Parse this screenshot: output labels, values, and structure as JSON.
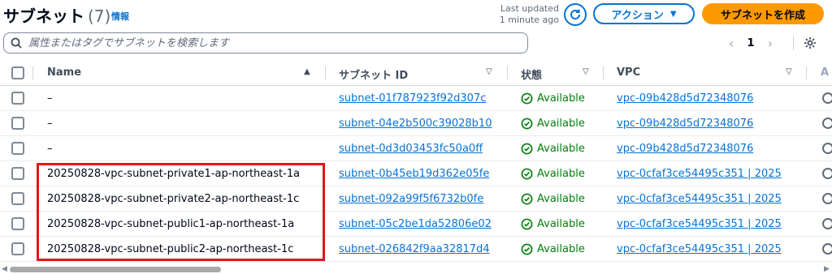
{
  "header": {
    "title": "サブネット",
    "count": "(7)",
    "info_link": "情報",
    "last_updated_line1": "Last updated",
    "last_updated_line2": "1 minute ago",
    "action_label": "アクション",
    "create_label": "サブネットを作成"
  },
  "search": {
    "placeholder": "属性またはタグでサブネットを検索します"
  },
  "pagination": {
    "current_page": "1"
  },
  "columns": {
    "name": "Name",
    "subnet_id": "サブネット ID",
    "state": "状態",
    "vpc": "VPC"
  },
  "rows": [
    {
      "name": "–",
      "subnet_id": "subnet-01f787923f92d307c",
      "state": "Available",
      "vpc": "vpc-09b428d5d72348076"
    },
    {
      "name": "–",
      "subnet_id": "subnet-04e2b500c39028b10",
      "state": "Available",
      "vpc": "vpc-09b428d5d72348076"
    },
    {
      "name": "–",
      "subnet_id": "subnet-0d3d03453fc50a0ff",
      "state": "Available",
      "vpc": "vpc-09b428d5d72348076"
    },
    {
      "name": "20250828-vpc-subnet-private1-ap-northeast-1a",
      "subnet_id": "subnet-0b45eb19d362e05fe",
      "state": "Available",
      "vpc": "vpc-0cfaf3ce54495c351 | 2025"
    },
    {
      "name": "20250828-vpc-subnet-private2-ap-northeast-1c",
      "subnet_id": "subnet-092a99f5f6732b0fe",
      "state": "Available",
      "vpc": "vpc-0cfaf3ce54495c351 | 2025"
    },
    {
      "name": "20250828-vpc-subnet-public1-ap-northeast-1a",
      "subnet_id": "subnet-05c2be1da52806e02",
      "state": "Available",
      "vpc": "vpc-0cfaf3ce54495c351 | 2025"
    },
    {
      "name": "20250828-vpc-subnet-public2-ap-northeast-1c",
      "subnet_id": "subnet-026842f9aa32817d4",
      "state": "Available",
      "vpc": "vpc-0cfaf3ce54495c351 | 2025"
    }
  ],
  "colors": {
    "link": "#0972d3",
    "primary_button": "#ff9900",
    "status_available": "#037f0c",
    "highlight": "#e5141a"
  }
}
